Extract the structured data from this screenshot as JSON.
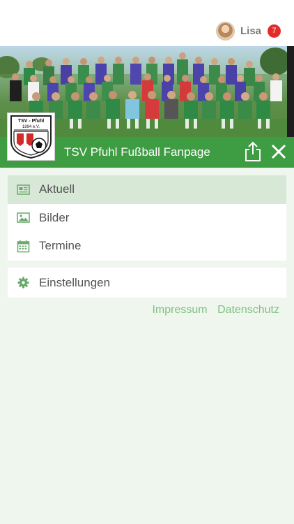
{
  "user": {
    "name": "Lisa",
    "notifications": "7"
  },
  "club": {
    "title": "TSV Pfuhl Fußball Fanpage",
    "logo_text_line1": "TSV - Pfuhl",
    "logo_text_line2": "1894 e.V."
  },
  "menu": {
    "items": [
      {
        "label": "Aktuell",
        "icon": "newspaper-icon",
        "active": true
      },
      {
        "label": "Bilder",
        "icon": "image-icon",
        "active": false
      },
      {
        "label": "Termine",
        "icon": "calendar-icon",
        "active": false
      }
    ],
    "settings": {
      "label": "Einstellungen",
      "icon": "gear-icon"
    }
  },
  "footer": {
    "impressum": "Impressum",
    "datenschutz": "Datenschutz"
  },
  "colors": {
    "brand_green": "#3e9c42",
    "background": "#eff6ee",
    "active_item": "#d8e8d7",
    "icon_green": "#6aa96c",
    "badge_red": "#e32b2b"
  }
}
